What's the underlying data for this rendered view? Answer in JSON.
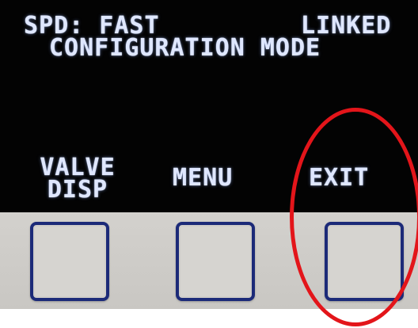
{
  "display": {
    "speed_label": "SPD: FAST",
    "linked_label": "LINKED",
    "mode_label": "CONFIGURATION MODE",
    "softkeys": [
      {
        "line1": "VALVE",
        "line2": "DISP"
      },
      {
        "line1": "MENU"
      },
      {
        "line1": "EXIT"
      }
    ]
  },
  "colors": {
    "screen_background": "#030303",
    "lcd_text": "#dfe7ff",
    "panel": "#d3d1cd",
    "key_border": "#1c2a78",
    "annotation_circle": "#e3151a"
  }
}
